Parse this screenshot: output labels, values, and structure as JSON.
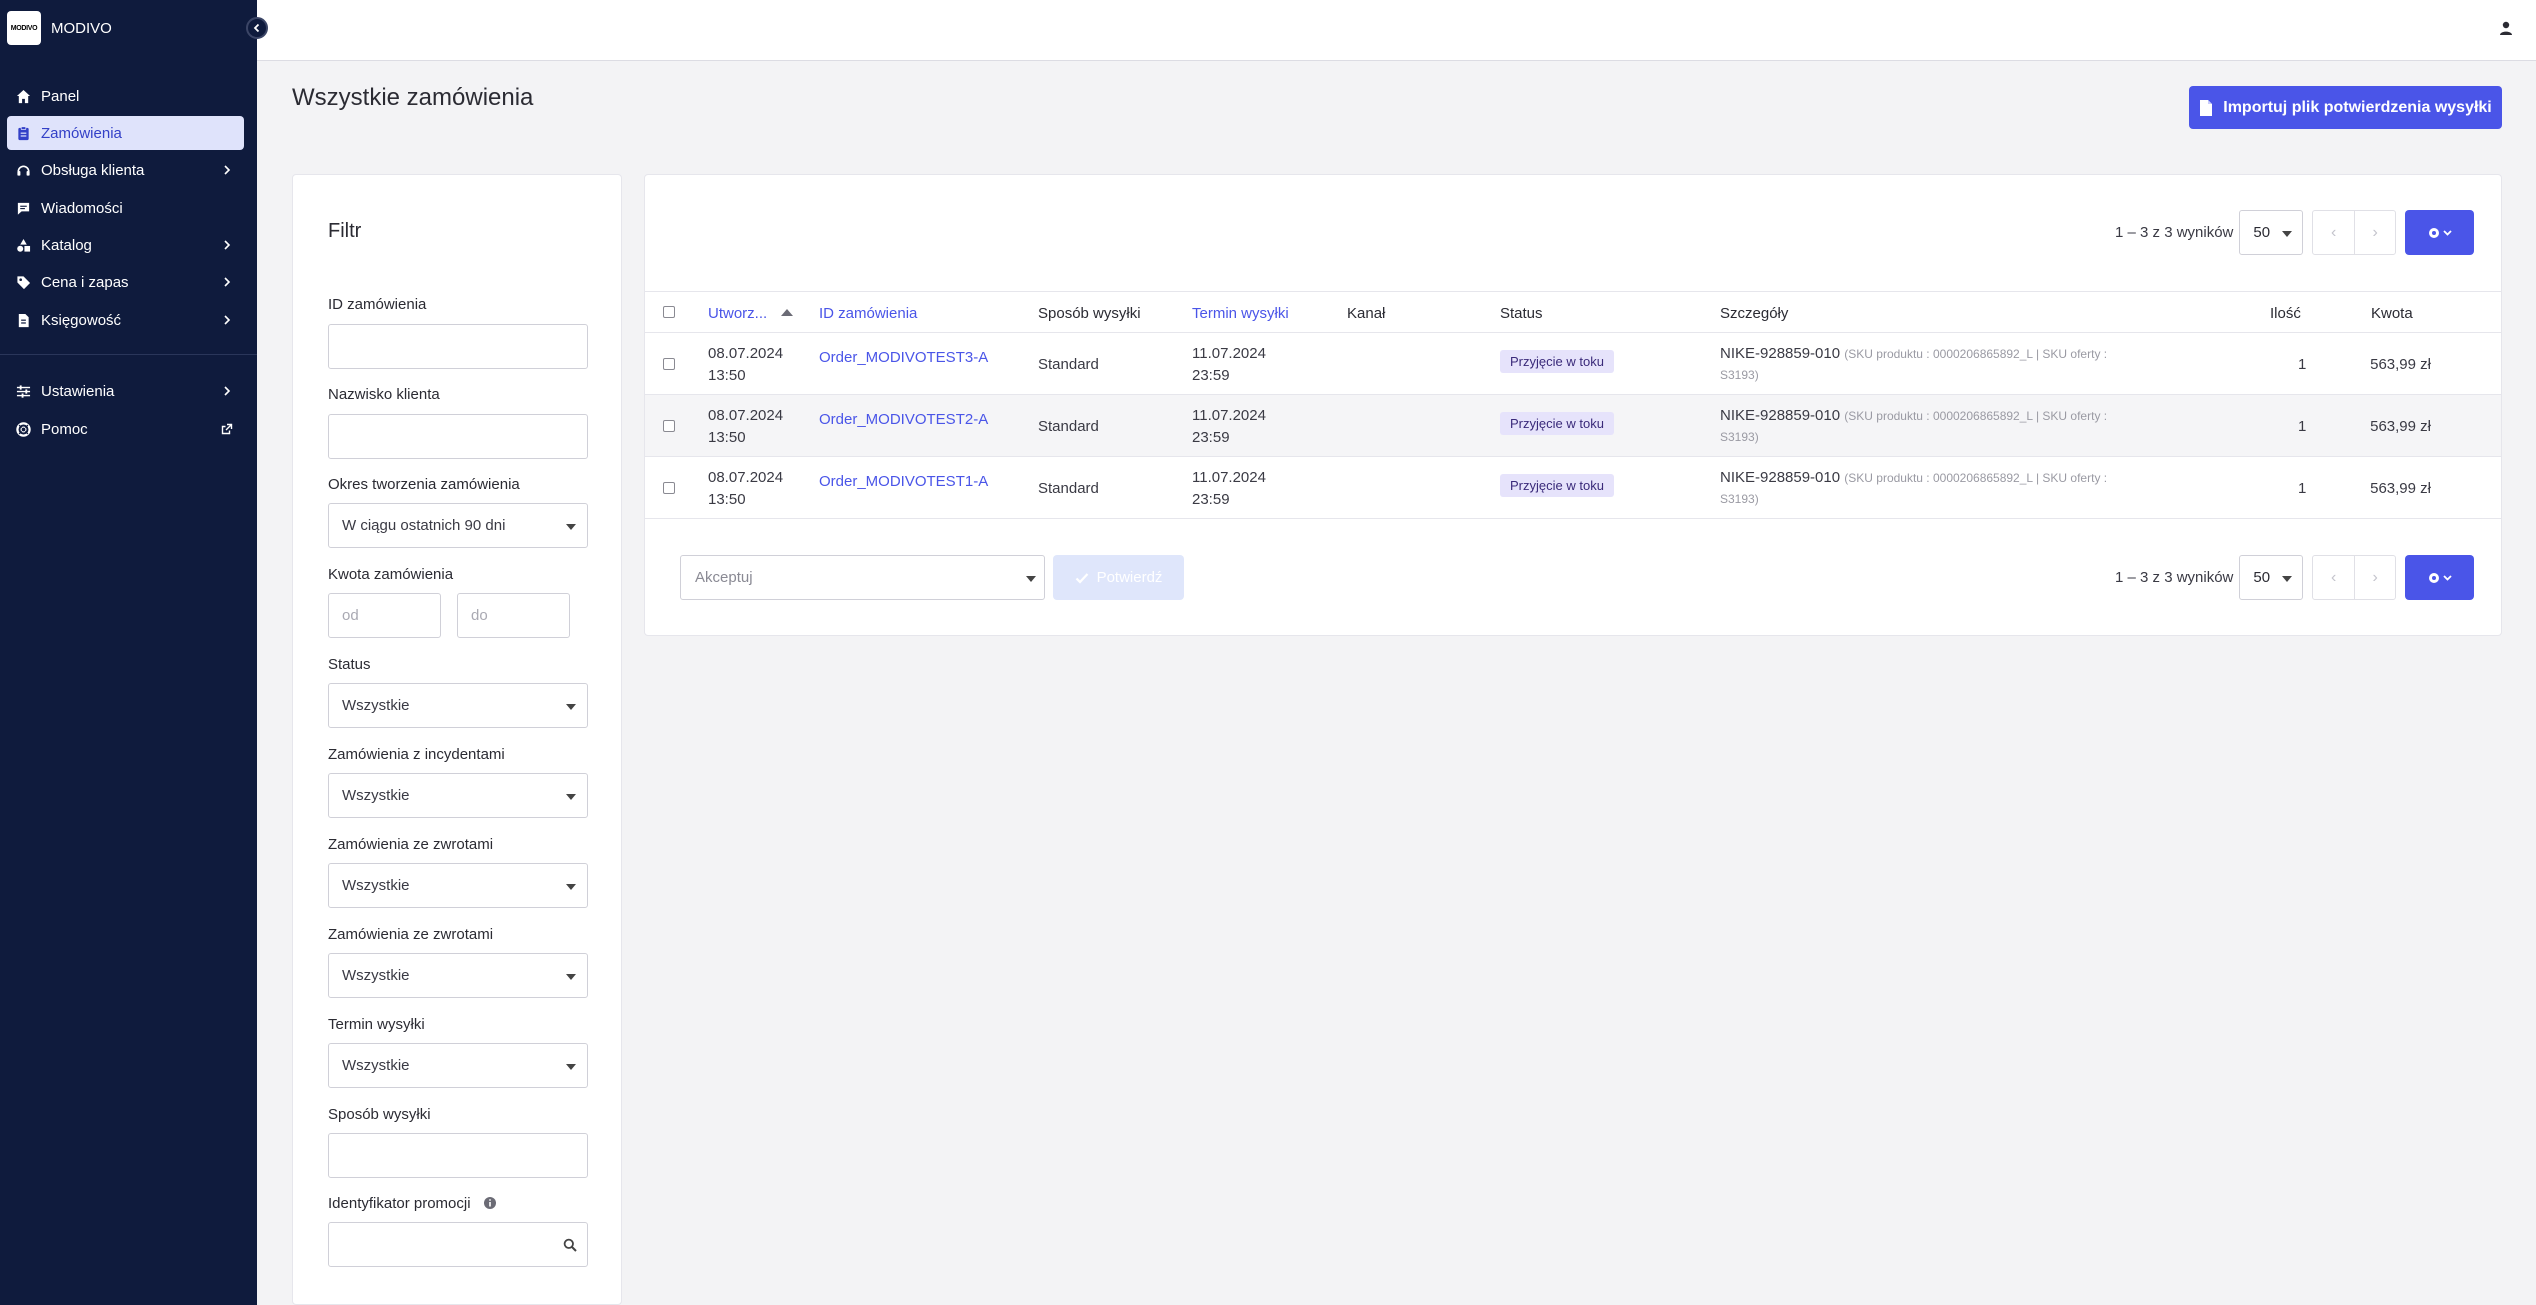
{
  "brand": {
    "logo_text": "MODIVO",
    "name": "MODIVO"
  },
  "sidebar": {
    "items": [
      {
        "label": "Panel",
        "icon": "home-icon",
        "has_chevron": false,
        "active": false
      },
      {
        "label": "Zamówienia",
        "icon": "clipboard-icon",
        "has_chevron": false,
        "active": true
      },
      {
        "label": "Obsługa klienta",
        "icon": "headset-icon",
        "has_chevron": true,
        "active": false
      },
      {
        "label": "Wiadomości",
        "icon": "message-icon",
        "has_chevron": false,
        "active": false
      },
      {
        "label": "Katalog",
        "icon": "shapes-icon",
        "has_chevron": true,
        "active": false
      },
      {
        "label": "Cena i zapas",
        "icon": "tag-icon",
        "has_chevron": true,
        "active": false
      },
      {
        "label": "Księgowość",
        "icon": "invoice-icon",
        "has_chevron": true,
        "active": false
      },
      {
        "label": "Ustawienia",
        "icon": "sliders-icon",
        "has_chevron": true,
        "active": false
      },
      {
        "label": "Pomoc",
        "icon": "lifebuoy-icon",
        "has_chevron": false,
        "external": true,
        "active": false
      }
    ]
  },
  "page": {
    "title": "Wszystkie zamówienia",
    "import_button": "Importuj plik potwierdzenia wysyłki"
  },
  "filter": {
    "title": "Filtr",
    "order_id_label": "ID zamówienia",
    "customer_name_label": "Nazwisko klienta",
    "created_period_label": "Okres tworzenia zamówienia",
    "created_period_value": "W ciągu ostatnich 90 dni",
    "amount_label": "Kwota zamówienia",
    "amount_from_placeholder": "od",
    "amount_to_placeholder": "do",
    "status_label": "Status",
    "status_value": "Wszystkie",
    "incidents_label": "Zamówienia z incydentami",
    "incidents_value": "Wszystkie",
    "returns_label": "Zamówienia ze zwrotami",
    "returns_value": "Wszystkie",
    "returns2_label": "Zamówienia ze zwrotami",
    "returns2_value": "Wszystkie",
    "ship_deadline_label": "Termin wysyłki",
    "ship_deadline_value": "Wszystkie",
    "ship_method_label": "Sposób wysyłki",
    "promo_label": "Identyfikator promocji"
  },
  "pagination": {
    "range_text": "1 – 3 z 3 wyników",
    "per_page": "50",
    "prev": "‹",
    "next": "›"
  },
  "table": {
    "headers": {
      "created": "Utworz...",
      "order_id": "ID zamówienia",
      "ship_method": "Sposób wysyłki",
      "ship_deadline": "Termin wysyłki",
      "channel": "Kanał",
      "status": "Status",
      "details": "Szczegóły",
      "qty": "Ilość",
      "amount": "Kwota"
    },
    "rows": [
      {
        "created_date": "08.07.2024",
        "created_time": "13:50",
        "order_id": "Order_MODIVOTEST3-A",
        "ship_method": "Standard",
        "deadline_date": "11.07.2024",
        "deadline_time": "23:59",
        "channel": "",
        "status": "Przyjęcie w toku",
        "product": "NIKE-928859-010",
        "sku_line1": "(SKU produktu : 0000206865892_L | SKU oferty :",
        "sku_line2": "S3193)",
        "qty": "1",
        "amount": "563,99 zł"
      },
      {
        "created_date": "08.07.2024",
        "created_time": "13:50",
        "order_id": "Order_MODIVOTEST2-A",
        "ship_method": "Standard",
        "deadline_date": "11.07.2024",
        "deadline_time": "23:59",
        "channel": "",
        "status": "Przyjęcie w toku",
        "product": "NIKE-928859-010",
        "sku_line1": "(SKU produktu : 0000206865892_L | SKU oferty :",
        "sku_line2": "S3193)",
        "qty": "1",
        "amount": "563,99 zł"
      },
      {
        "created_date": "08.07.2024",
        "created_time": "13:50",
        "order_id": "Order_MODIVOTEST1-A",
        "ship_method": "Standard",
        "deadline_date": "11.07.2024",
        "deadline_time": "23:59",
        "channel": "",
        "status": "Przyjęcie w toku",
        "product": "NIKE-928859-010",
        "sku_line1": "(SKU produktu : 0000206865892_L | SKU oferty :",
        "sku_line2": "S3193)",
        "qty": "1",
        "amount": "563,99 zł"
      }
    ]
  },
  "bulk": {
    "action_placeholder": "Akceptuj",
    "confirm_label": "Potwierdź"
  },
  "colors": {
    "sidebar_bg": "#0f1b3d",
    "accent": "#4a55e8",
    "active_nav_bg": "#dfe3fb",
    "status_badge_bg": "#e6e3fb"
  }
}
